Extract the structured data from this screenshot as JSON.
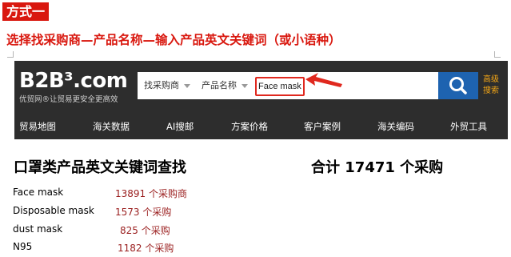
{
  "method_tag": "方式一",
  "steps": "选择找采购商—产品名称—输入产品英文关键词（或小语种）",
  "header": {
    "logo": "B2B³.com",
    "tagline": "优贸网®让贸易更安全更高效",
    "select_buyer": "找采购商",
    "select_product": "产品名称",
    "search_value": "Face mask",
    "advanced_search": "高级搜索",
    "search_icon": "search-icon"
  },
  "nav": {
    "items": [
      "贸易地图",
      "海关数据",
      "AI搜邮",
      "方案价格",
      "客户案例",
      "海关编码",
      "外贸工具"
    ]
  },
  "results": {
    "title": "口罩类产品英文关键词查找",
    "total": "合计 17471 个采购",
    "rows": [
      {
        "keyword": "Face mask",
        "count": "13891 个采购商"
      },
      {
        "keyword": "Disposable mask",
        "count": "1573 个采购"
      },
      {
        "keyword": "dust mask",
        "count": "825 个采购"
      },
      {
        "keyword": "N95",
        "count": "1182 个采购"
      }
    ]
  },
  "colors": {
    "accent_red": "#d9180f",
    "header_bg": "#2d2d2d",
    "search_blue": "#1e63b0",
    "advanced_orange": "#f2a516",
    "count_red": "#9a1e1e"
  }
}
